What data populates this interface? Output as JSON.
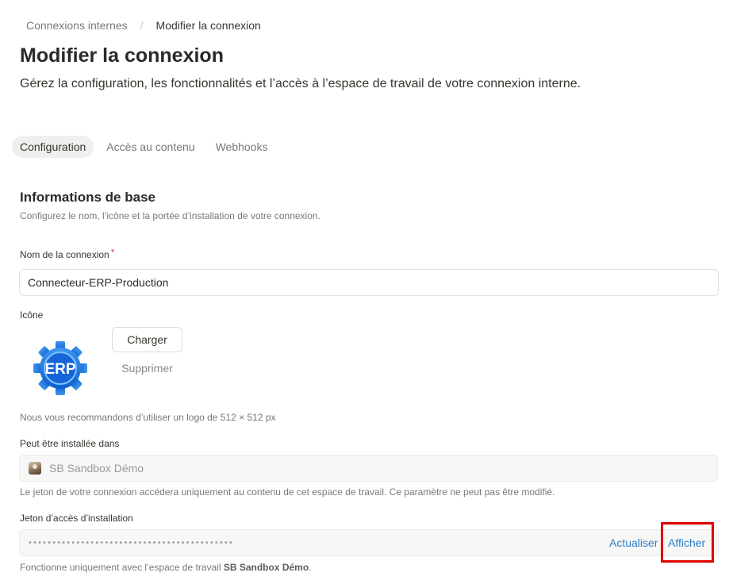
{
  "breadcrumb": {
    "parent": "Connexions internes",
    "separator": "/",
    "current": "Modifier la connexion"
  },
  "page": {
    "title": "Modifier la connexion",
    "subtitle": "Gérez la configuration, les fonctionnalités et l’accès à l’espace de travail de votre connexion interne."
  },
  "tabs": [
    {
      "label": "Configuration",
      "active": true
    },
    {
      "label": "Accès au contenu",
      "active": false
    },
    {
      "label": "Webhooks",
      "active": false
    }
  ],
  "section": {
    "title": "Informations de base",
    "description": "Configurez le nom, l’icône et la portée d’installation de votre connexion."
  },
  "name_field": {
    "label": "Nom de la connexion",
    "required_mark": "*",
    "value": "Connecteur-ERP-Production"
  },
  "icon_field": {
    "label": "Icône",
    "logo_text": "ERP",
    "upload_label": "Charger",
    "remove_label": "Supprimer",
    "hint": "Nous vous recommandons d’utiliser un logo de 512 × 512 px"
  },
  "install_field": {
    "label": "Peut être installée dans",
    "workspace": "SB Sandbox Démo",
    "hint": "Le jeton de votre connexion accédera uniquement au contenu de cet espace de travail. Ce paramètre ne peut pas être modifié."
  },
  "token_field": {
    "label": "Jeton d’accès d’installation",
    "masked_value": "•••••••••••••••••••••••••••••••••••••••••••",
    "refresh_label": "Actualiser",
    "show_label": "Afficher",
    "hint_prefix": "Fonctionne uniquement avec l’espace de travail ",
    "hint_workspace": "SB Sandbox Démo",
    "hint_suffix": "."
  },
  "colors": {
    "accent_link": "#2f7fc7",
    "required": "#e03e3e",
    "highlight": "#e00000",
    "logo_blue": "#1a73e8"
  }
}
